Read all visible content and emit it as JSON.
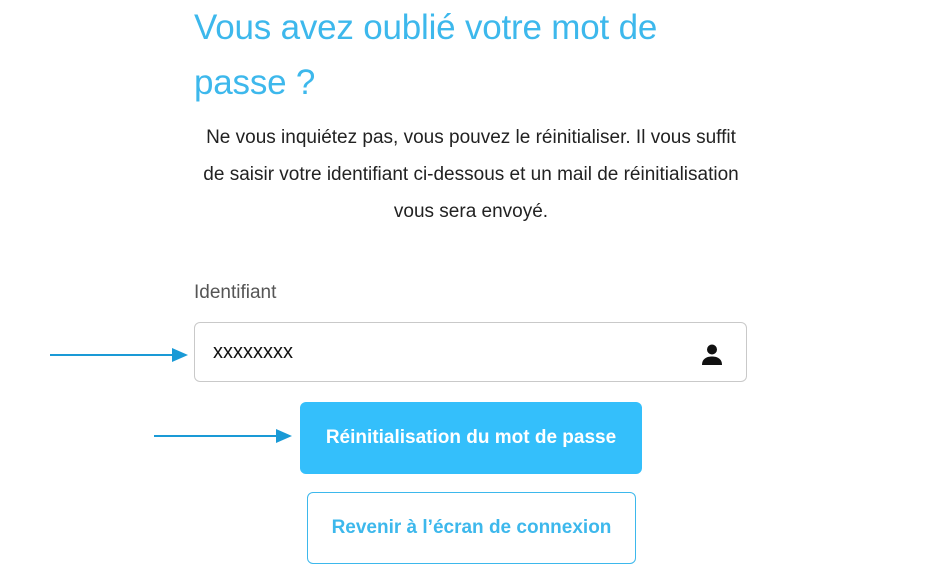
{
  "page": {
    "title": "Vous avez oublié votre mot de passe ?",
    "intro": "Ne vous inquiétez pas, vous pouvez le réinitialiser. Il vous suffit de saisir votre identifiant ci-dessous et un mail de réinitialisation vous sera envoyé."
  },
  "form": {
    "identifier_label": "Identifiant",
    "identifier_value": "xxxxxxxx",
    "identifier_icon": "user-icon",
    "reset_button_label": "Réinitialisation du mot de passe",
    "back_button_label": "Revenir à l’écran de connexion"
  },
  "annotations": {
    "arrow_color": "#1a9ad6"
  },
  "colors": {
    "accent": "#3db8ec",
    "button_primary": "#34bffb"
  }
}
